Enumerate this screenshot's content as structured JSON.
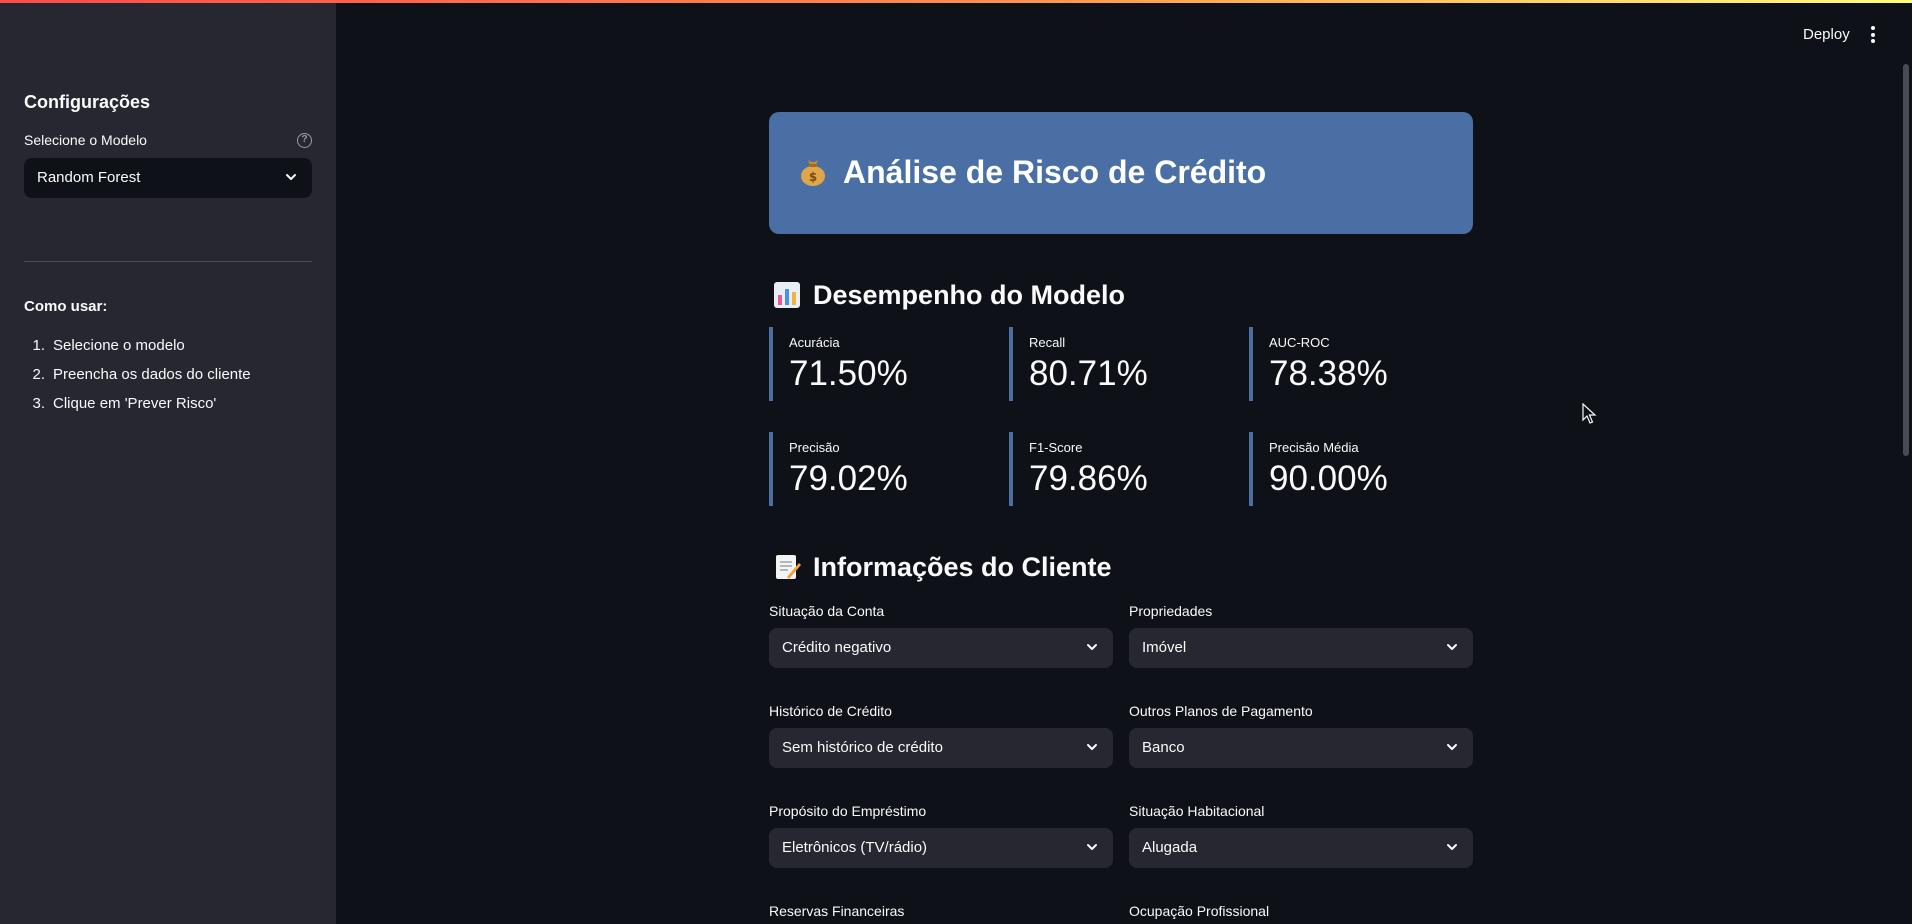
{
  "sidebar": {
    "title": "Configurações",
    "model_label": "Selecione o Modelo",
    "help_glyph": "?",
    "model_value": "Random Forest",
    "howto_title": "Como usar:",
    "steps": [
      {
        "num": "1.",
        "text": "Selecione o modelo"
      },
      {
        "num": "2.",
        "text": "Preencha os dados do cliente"
      },
      {
        "num": "3.",
        "text": "Clique em 'Prever Risco'"
      }
    ]
  },
  "header": {
    "deploy_label": "Deploy"
  },
  "banner": {
    "title": "Análise de Risco de Crédito",
    "icon": "money-bag-icon"
  },
  "performance": {
    "title": "Desempenho do Modelo",
    "icon": "bar-chart-icon",
    "metrics": [
      {
        "label": "Acurácia",
        "value": "71.50%"
      },
      {
        "label": "Recall",
        "value": "80.71%"
      },
      {
        "label": "AUC-ROC",
        "value": "78.38%"
      },
      {
        "label": "Precisão",
        "value": "79.02%"
      },
      {
        "label": "F1-Score",
        "value": "79.86%"
      },
      {
        "label": "Precisão Média",
        "value": "90.00%"
      }
    ]
  },
  "client": {
    "title": "Informações do Cliente",
    "icon": "memo-icon",
    "fields": [
      {
        "label": "Situação da Conta",
        "value": "Crédito negativo"
      },
      {
        "label": "Propriedades",
        "value": "Imóvel"
      },
      {
        "label": "Histórico de Crédito",
        "value": "Sem histórico de crédito"
      },
      {
        "label": "Outros Planos de Pagamento",
        "value": "Banco"
      },
      {
        "label": "Propósito do Empréstimo",
        "value": "Eletrônicos (TV/rádio)"
      },
      {
        "label": "Situação Habitacional",
        "value": "Alugada"
      },
      {
        "label": "Reservas Financeiras",
        "value": ""
      },
      {
        "label": "Ocupação Profissional",
        "value": ""
      }
    ]
  },
  "colors": {
    "accent": "#4a6fa5",
    "background": "#0e1117",
    "sidebar": "#262730"
  }
}
